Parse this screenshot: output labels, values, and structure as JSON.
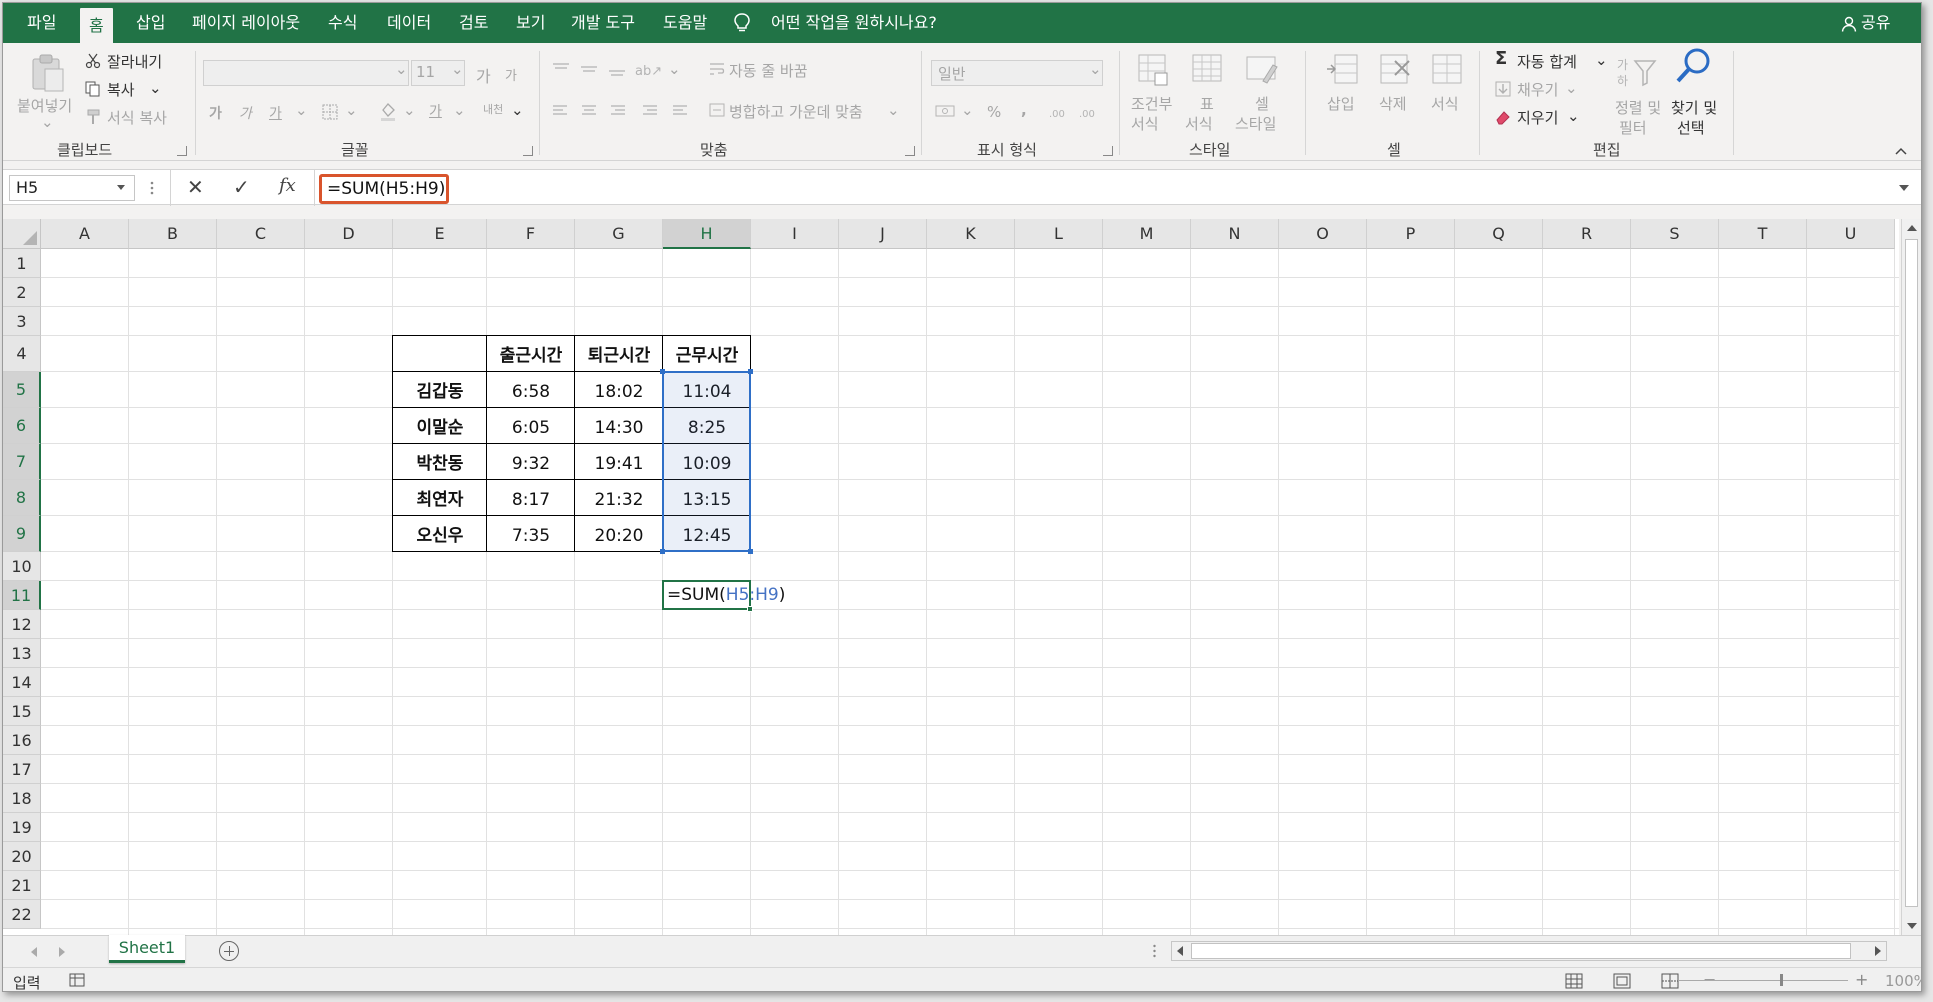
{
  "ribbon_tabs": [
    "파일",
    "홈",
    "삽입",
    "페이지 레이아웃",
    "수식",
    "데이터",
    "검토",
    "보기",
    "개발 도구",
    "도움말"
  ],
  "tell_me": "어떤 작업을 원하시나요?",
  "share": "공유",
  "clipboard": {
    "paste": "붙여넣기",
    "cut": "잘라내기",
    "copy": "복사",
    "format_painter": "서식 복사",
    "group": "클립보드"
  },
  "font": {
    "font_size": "11",
    "group": "글꼴",
    "grow": "가",
    "shrink": "가",
    "bold": "가",
    "italic": "가",
    "underline": "가",
    "color_letter": "가",
    "phonetic": "내천"
  },
  "alignment": {
    "wrap": "자동 줄 바꿈",
    "merge": "병합하고 가운데 맞춤",
    "group": "맞춤"
  },
  "number": {
    "format": "일반",
    "percent": "%",
    "comma": ",",
    "group": "표시 형식"
  },
  "styles": {
    "conditional": [
      "조건부",
      "서식"
    ],
    "table": [
      "표",
      "서식"
    ],
    "cell": [
      "셀",
      "스타일"
    ],
    "group": "스타일"
  },
  "cells": {
    "insert": "삽입",
    "delete": "삭제",
    "format": "서식",
    "group": "셀"
  },
  "editing": {
    "autosum": "자동 합계",
    "fill": "채우기",
    "clear": "지우기",
    "sort": [
      "정렬 및",
      "필터"
    ],
    "find": [
      "찾기 및",
      "선택"
    ],
    "group": "편집"
  },
  "formula_bar": {
    "name_box": "H5",
    "cancel": "✕",
    "enter": "✓",
    "fx": "fx",
    "formula": "=SUM(H5:H9)"
  },
  "columns": [
    "A",
    "B",
    "C",
    "D",
    "E",
    "F",
    "G",
    "H",
    "I",
    "J",
    "K",
    "L",
    "M",
    "N",
    "O",
    "P",
    "Q",
    "R",
    "S",
    "T",
    "U"
  ],
  "rows": [
    "1",
    "2",
    "3",
    "4",
    "5",
    "6",
    "7",
    "8",
    "9",
    "10",
    "11",
    "12",
    "13",
    "14",
    "15",
    "16",
    "17",
    "18",
    "19",
    "20",
    "21",
    "22"
  ],
  "table": {
    "headers": [
      "",
      "출근시간",
      "퇴근시간",
      "근무시간"
    ],
    "rows": [
      [
        "김갑동",
        "6:58",
        "18:02",
        "11:04"
      ],
      [
        "이말순",
        "6:05",
        "14:30",
        "8:25"
      ],
      [
        "박찬동",
        "9:32",
        "19:41",
        "10:09"
      ],
      [
        "최연자",
        "8:17",
        "21:32",
        "13:15"
      ],
      [
        "오신우",
        "7:35",
        "20:20",
        "12:45"
      ]
    ]
  },
  "active_cell": {
    "prefix": "=SUM(",
    "ref": "H5:H9",
    "suffix": ")"
  },
  "sheet_tab": "Sheet1",
  "status": {
    "mode": "입력",
    "zoom": "100%",
    "zoom_minus": "−",
    "zoom_plus": "+"
  },
  "colors": {
    "brand": "#217346",
    "highlight_border": "#d9542c",
    "range_blue": "#2f6fc7",
    "ref_blue": "#4472c4"
  }
}
